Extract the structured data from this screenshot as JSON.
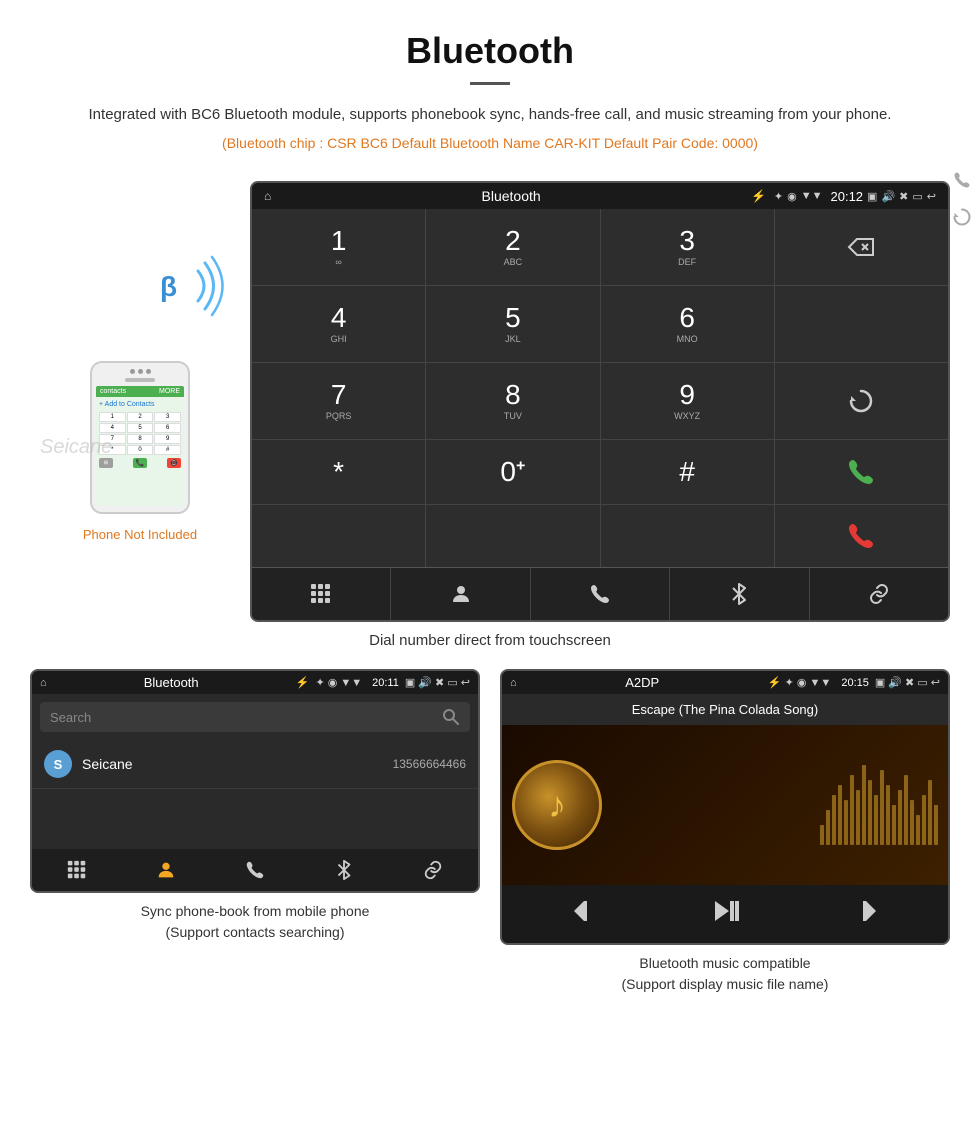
{
  "header": {
    "title": "Bluetooth",
    "description": "Integrated with BC6 Bluetooth module, supports phonebook sync, hands-free call, and music streaming from your phone.",
    "specs": "(Bluetooth chip : CSR BC6    Default Bluetooth Name CAR-KIT    Default Pair Code: 0000)"
  },
  "phone_area": {
    "not_included_label": "Phone Not Included",
    "watermark": "Seicane"
  },
  "dialpad_screen": {
    "status": {
      "home_icon": "⌂",
      "title": "Bluetooth",
      "usb_icon": "⚡",
      "bluetooth_icon": "✦",
      "location_icon": "◉",
      "signal_icon": "▼",
      "time": "20:12",
      "camera_icon": "📷",
      "volume_icon": "🔊",
      "back_icon": "↩"
    },
    "keys": [
      {
        "main": "1",
        "sub": "∞"
      },
      {
        "main": "2",
        "sub": "ABC"
      },
      {
        "main": "3",
        "sub": "DEF"
      },
      {
        "main": "⌫",
        "sub": ""
      },
      {
        "main": "4",
        "sub": "GHI"
      },
      {
        "main": "5",
        "sub": "JKL"
      },
      {
        "main": "6",
        "sub": "MNO"
      },
      {
        "main": "",
        "sub": ""
      },
      {
        "main": "7",
        "sub": "PQRS"
      },
      {
        "main": "8",
        "sub": "TUV"
      },
      {
        "main": "9",
        "sub": "WXYZ"
      },
      {
        "main": "↺",
        "sub": ""
      },
      {
        "main": "*",
        "sub": ""
      },
      {
        "main": "0",
        "sub": "+"
      },
      {
        "main": "#",
        "sub": ""
      },
      {
        "main": "📞",
        "sub": "call"
      },
      {
        "main": "",
        "sub": ""
      },
      {
        "main": "📵",
        "sub": "end"
      }
    ],
    "bottom_icons": [
      "⊞",
      "👤",
      "📞",
      "✦",
      "🔗"
    ]
  },
  "main_caption": "Dial number direct from touchscreen",
  "phonebook_screen": {
    "status": {
      "home_icon": "⌂",
      "title": "Bluetooth",
      "usb_icon": "⚡",
      "time": "20:11"
    },
    "search_placeholder": "Search",
    "contacts": [
      {
        "initial": "S",
        "name": "Seicane",
        "number": "13566664466"
      }
    ],
    "bottom_icons": [
      "⊞",
      "👤",
      "📞",
      "✦",
      "🔗"
    ]
  },
  "music_screen": {
    "status": {
      "home_icon": "⌂",
      "title": "A2DP",
      "time": "20:15"
    },
    "song_title": "Escape (The Pina Colada Song)",
    "controls": [
      "⏮",
      "⏯",
      "⏭"
    ],
    "eq_bars": [
      20,
      35,
      50,
      60,
      45,
      70,
      55,
      80,
      65,
      50,
      75,
      60,
      40,
      55,
      70,
      45,
      30,
      50,
      65,
      40
    ]
  },
  "captions": {
    "phonebook": "Sync phone-book from mobile phone\n(Support contacts searching)",
    "music": "Bluetooth music compatible\n(Support display music file name)"
  }
}
